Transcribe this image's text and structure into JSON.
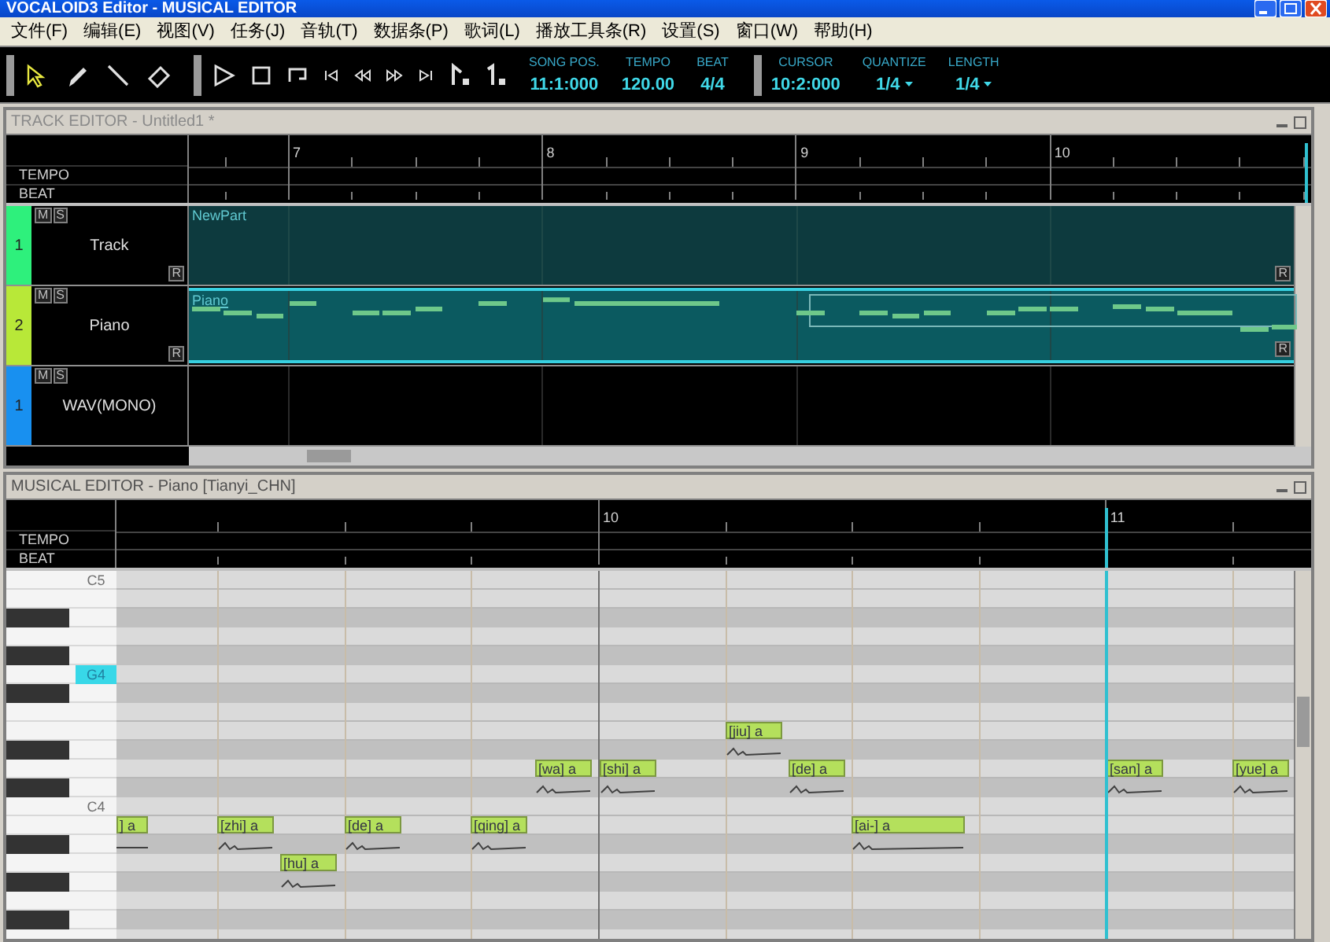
{
  "window": {
    "title": "VOCALOID3 Editor - MUSICAL EDITOR"
  },
  "menu": [
    {
      "label": "文件(F)"
    },
    {
      "label": "编辑(E)"
    },
    {
      "label": "视图(V)"
    },
    {
      "label": "任务(J)"
    },
    {
      "label": "音轨(T)"
    },
    {
      "label": "数据条(P)"
    },
    {
      "label": "歌词(L)"
    },
    {
      "label": "播放工具条(R)"
    },
    {
      "label": "设置(S)"
    },
    {
      "label": "窗口(W)"
    },
    {
      "label": "帮助(H)"
    }
  ],
  "toolbar": {
    "tools": [
      {
        "kind": "pointer",
        "selected": true
      },
      {
        "kind": "pencil",
        "selected": false
      },
      {
        "kind": "line",
        "selected": false
      },
      {
        "kind": "eraser",
        "selected": false
      }
    ],
    "position_readouts": [
      {
        "label": "SONG POS.",
        "value": "11:1:000",
        "dropdown": false
      },
      {
        "label": "TEMPO",
        "value": "120.00",
        "dropdown": false
      },
      {
        "label": "BEAT",
        "value": "4/4",
        "dropdown": false
      }
    ],
    "edit_readouts": [
      {
        "label": "CURSOR",
        "value": "10:2:000",
        "dropdown": false
      },
      {
        "label": "QUANTIZE",
        "value": "1/4",
        "dropdown": true
      },
      {
        "label": "LENGTH",
        "value": "1/4",
        "dropdown": true
      }
    ]
  },
  "track_editor": {
    "title": "TRACK EDITOR - Untitled1 *",
    "ruler_rows": [
      "TEMPO",
      "BEAT"
    ],
    "bars": [
      "7",
      "8",
      "9",
      "10"
    ],
    "tracks": [
      {
        "number": "1",
        "name": "Track",
        "color": "#2ef07c",
        "buttons": [
          "M",
          "S"
        ],
        "render": "R",
        "part": {
          "name": "NewPart",
          "kind": "plain",
          "selected": false,
          "end_mark": "R"
        }
      },
      {
        "number": "2",
        "name": "Piano",
        "color": "#b8e838",
        "buttons": [
          "M",
          "S"
        ],
        "render": "R",
        "part": {
          "name": "Piano",
          "kind": "notes",
          "selected": true,
          "end_mark": "R"
        }
      },
      {
        "number": "1",
        "name": "WAV(MONO)",
        "color": "#1890f0",
        "buttons": [
          "M",
          "S"
        ]
      }
    ]
  },
  "musical_editor": {
    "title": "MUSICAL EDITOR - Piano [Tianyi_CHN]",
    "ruler_rows": [
      "TEMPO",
      "BEAT"
    ],
    "bars": [
      "10",
      "11"
    ],
    "keys": [
      {
        "label": "C5",
        "selected": false
      },
      {
        "label": "G4",
        "selected": true
      },
      {
        "label": "C4",
        "selected": false
      }
    ],
    "notes": [
      {
        "lyric": "] a"
      },
      {
        "lyric": "[zhi] a"
      },
      {
        "lyric": "[hu] a"
      },
      {
        "lyric": "[de] a"
      },
      {
        "lyric": "[qing] a"
      },
      {
        "lyric": "[wa] a"
      },
      {
        "lyric": "[shi] a"
      },
      {
        "lyric": "[jiu] a"
      },
      {
        "lyric": "[de] a"
      },
      {
        "lyric": "[ai-] a"
      },
      {
        "lyric": "[san] a"
      },
      {
        "lyric": "[yue] a"
      }
    ]
  }
}
